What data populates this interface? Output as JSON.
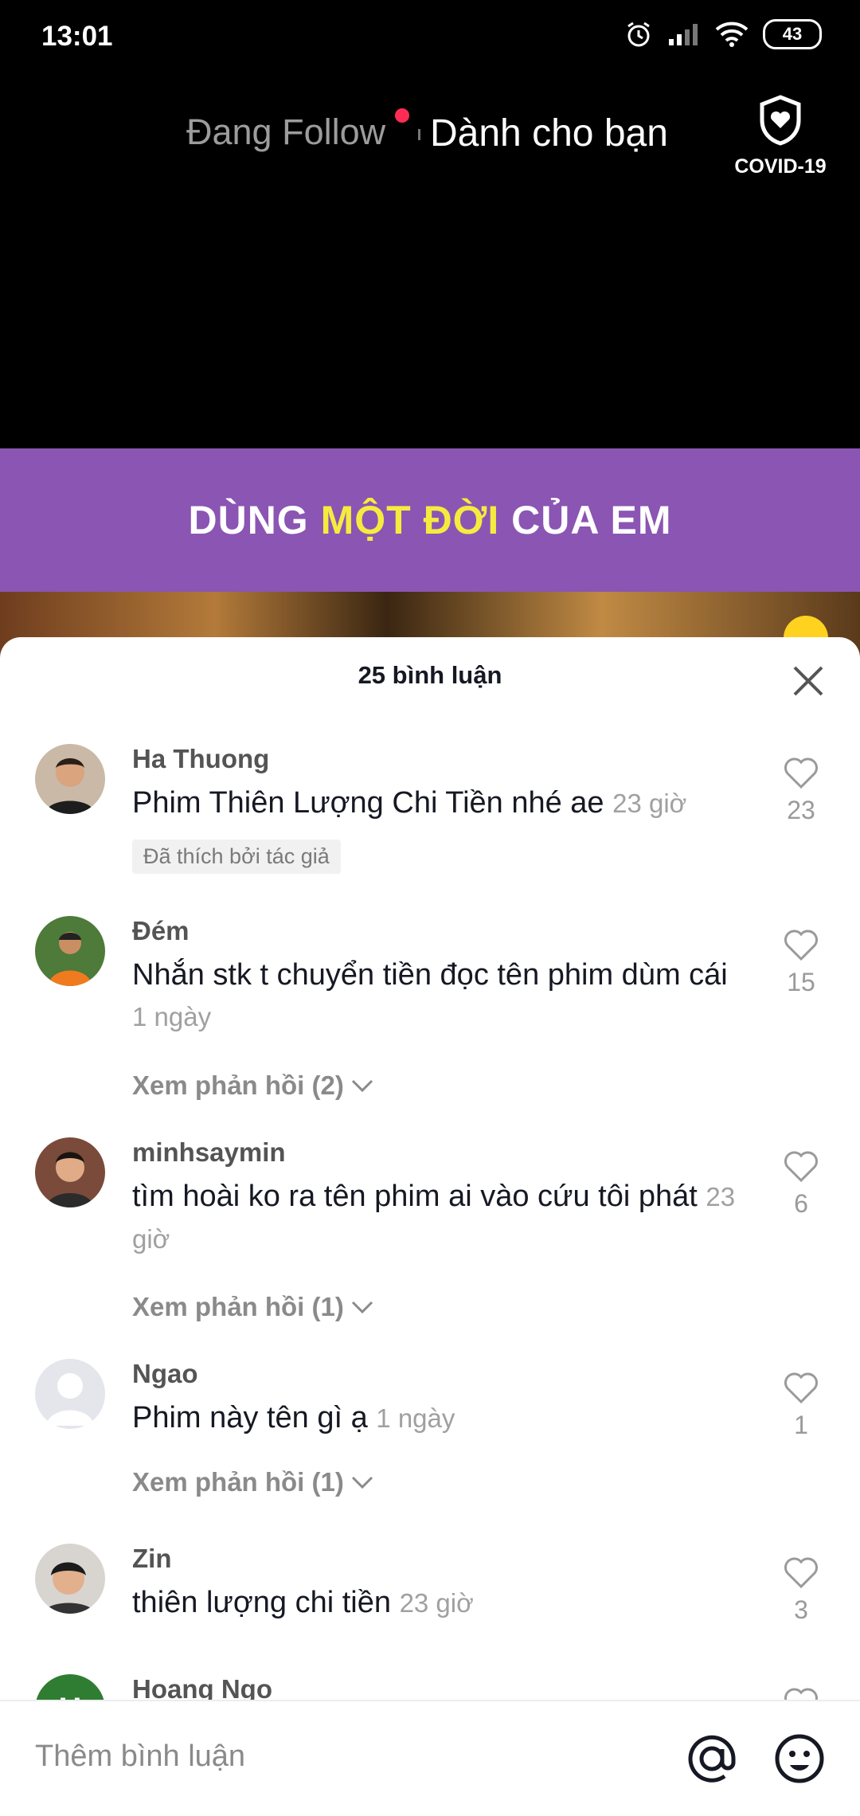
{
  "status_bar": {
    "time": "13:01",
    "battery": "43"
  },
  "top_nav": {
    "following": "Đang Follow",
    "for_you": "Dành cho bạn",
    "covid_label": "COVID-19"
  },
  "video": {
    "banner_part1": "DÙNG ",
    "banner_highlight": "MỘT ĐỜI",
    "banner_part2": " CỦA EM"
  },
  "comments_sheet": {
    "title": "25 bình luận",
    "comments": [
      {
        "username": "Ha Thuong",
        "text": "Phim Thiên Lượng Chi Tiền nhé ae",
        "time": "23 giờ",
        "likes": "23",
        "badge": "Đã thích bởi tác giả"
      },
      {
        "username": "Đém",
        "text": "Nhắn stk t chuyển tiền đọc tên phim dùm cái",
        "time": "1 ngày",
        "likes": "15",
        "replies": "Xem phản hồi (2)"
      },
      {
        "username": "minhsaymin",
        "text": "tìm hoài ko ra tên phim ai vào cứu tôi phát",
        "time": "23 giờ",
        "likes": "6",
        "replies": "Xem phản hồi (1)"
      },
      {
        "username": "Ngao",
        "text": "Phim này tên gì ạ",
        "time": "1 ngày",
        "likes": "1",
        "replies": "Xem phản hồi (1)"
      },
      {
        "username": "Zin",
        "text": "thiên lượng chi tiền",
        "time": "23 giờ",
        "likes": "3"
      },
      {
        "username": "Hoang Ngo",
        "avatar_letter": "H"
      }
    ]
  },
  "input": {
    "placeholder": "Thêm bình luận"
  },
  "colors": {
    "accent": "#fe2c55",
    "banner": "#8b55b3",
    "highlight": "#f5eb3f"
  }
}
